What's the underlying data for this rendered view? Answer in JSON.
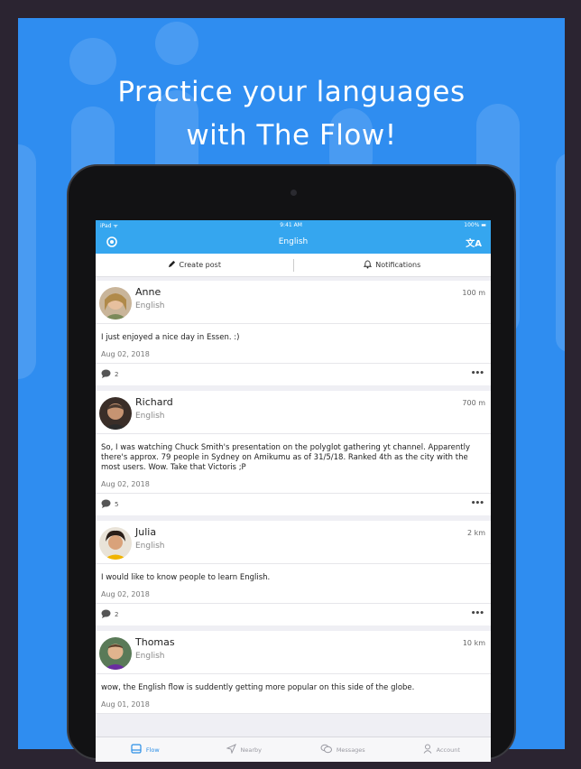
{
  "promo": {
    "headline_line1": "Practice your languages",
    "headline_line2": "with The Flow!",
    "background_color": "#2f8df0"
  },
  "statusbar": {
    "carrier": "iPad ᯤ",
    "time": "9:41 AM",
    "battery": "100% ▬"
  },
  "navbar": {
    "title": "English",
    "left_icon": "compass-icon",
    "right_icon": "translate-icon",
    "right_glyph": "文A"
  },
  "actions": {
    "create_post": "Create post",
    "notifications": "Notifications"
  },
  "posts": [
    {
      "name": "Anne",
      "language": "English",
      "distance": "100 m",
      "text": "I just enjoyed a nice day in Essen. :)",
      "date": "Aug 02, 2018",
      "comments": "2"
    },
    {
      "name": "Richard",
      "language": "English",
      "distance": "700 m",
      "text": "So, I was watching Chuck Smith's presentation on the polyglot gathering yt channel. Apparently there's approx. 79 people in Sydney on Amikumu as of 31/5/18. Ranked 4th as the city with the most users. Wow. Take that Victoris ;P",
      "date": "Aug 02, 2018",
      "comments": "5"
    },
    {
      "name": "Julia",
      "language": "English",
      "distance": "2 km",
      "text": "I would like to know people to learn English.",
      "date": "Aug 02, 2018",
      "comments": "2"
    },
    {
      "name": "Thomas",
      "language": "English",
      "distance": "10 km",
      "text": "wow, the English flow is suddently getting more popular on this side of the globe.",
      "date": "Aug 01, 2018",
      "comments": ""
    }
  ],
  "tabbar": {
    "flow": "Flow",
    "nearby": "Nearby",
    "messages": "Messages",
    "account": "Account"
  }
}
